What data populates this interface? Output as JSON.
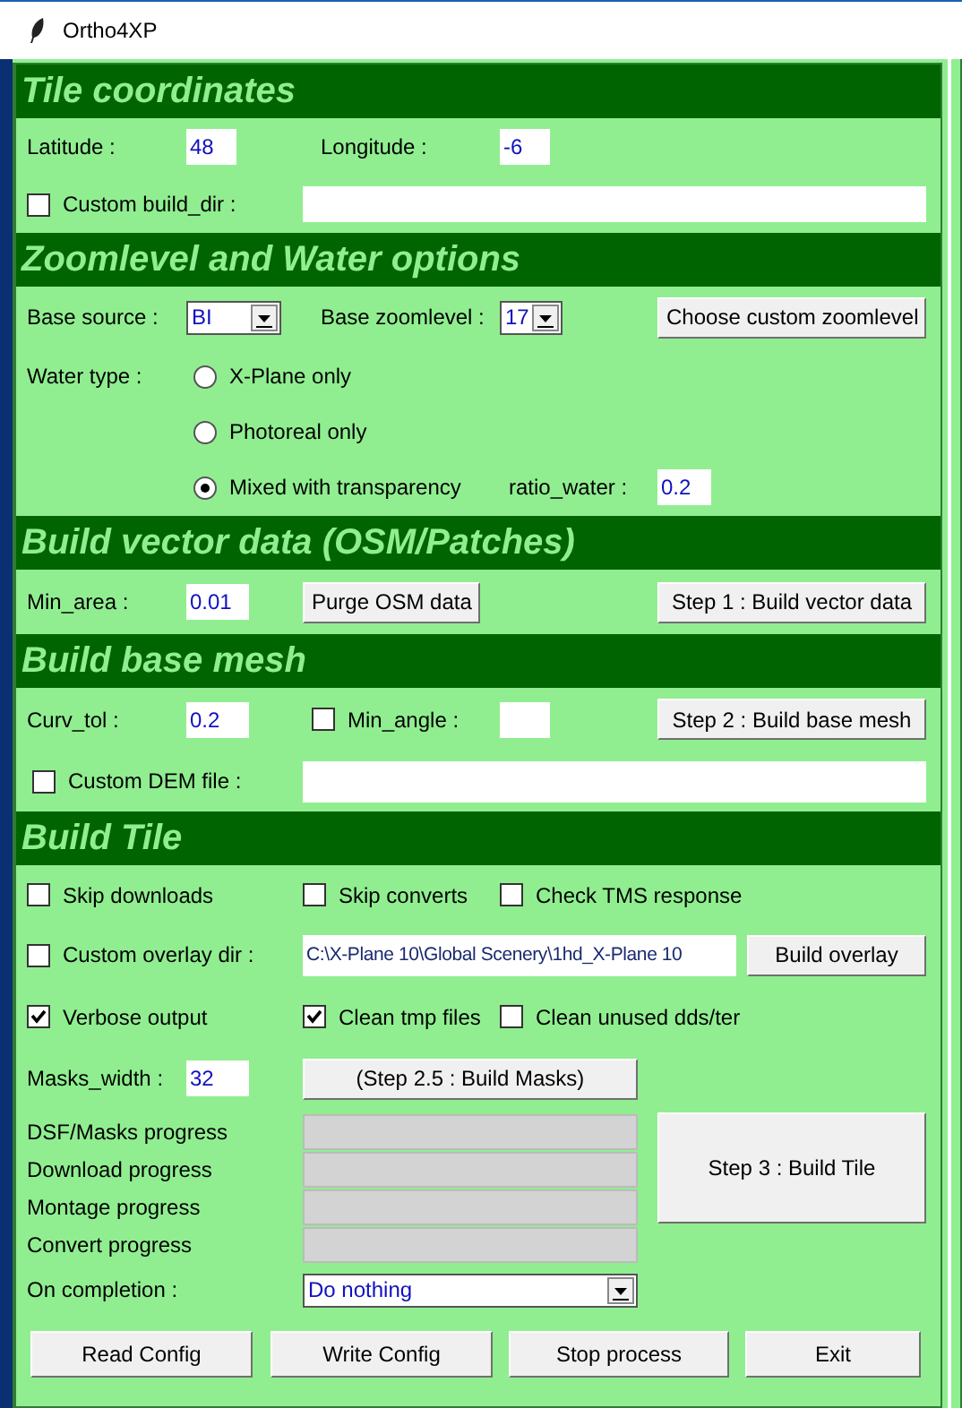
{
  "window": {
    "title": "Ortho4XP"
  },
  "tile_coordinates": {
    "title": "Tile coordinates",
    "latitude": {
      "label": "Latitude :",
      "value": "48"
    },
    "longitude": {
      "label": "Longitude :",
      "value": "-6"
    },
    "custom_build_dir": {
      "label": "Custom build_dir :",
      "checked": false
    }
  },
  "zoomlevel_water": {
    "title": "Zoomlevel and Water options",
    "base_source": {
      "label": "Base source :",
      "value": "BI"
    },
    "base_zoomlevel": {
      "label": "Base zoomlevel :",
      "value": "17"
    },
    "custom_zoomlevel_button": "Choose custom zoomlevel",
    "water_type_label": "Water type :",
    "water_types": [
      {
        "label": "X-Plane only",
        "selected": false
      },
      {
        "label": "Photoreal only",
        "selected": false
      },
      {
        "label": "Mixed with transparency",
        "selected": true
      }
    ],
    "ratio_water": {
      "label": "ratio_water :",
      "value": "0.2"
    }
  },
  "build_vector": {
    "title": "Build vector data (OSM/Patches)",
    "min_area": {
      "label": "Min_area :",
      "value": "0.01"
    },
    "purge_button": "Purge OSM data",
    "step1_button": "Step 1 : Build vector data"
  },
  "build_mesh": {
    "title": "Build base mesh",
    "curv_tol": {
      "label": "Curv_tol :",
      "value": "0.2"
    },
    "min_angle": {
      "label": "Min_angle :",
      "checked": false
    },
    "step2_button": "Step 2 : Build base mesh",
    "custom_dem": {
      "label": "Custom DEM file :",
      "checked": false
    }
  },
  "build_tile": {
    "title": "Build Tile",
    "options_row1": [
      {
        "label": "Skip downloads",
        "checked": false
      },
      {
        "label": "Skip converts",
        "checked": false
      },
      {
        "label": "Check TMS response",
        "checked": false
      }
    ],
    "custom_overlay": {
      "label": "Custom overlay dir :",
      "checked": false,
      "value": "C:\\X-Plane 10\\Global Scenery\\1hd_X-Plane 10"
    },
    "overlay_button": "Build overlay",
    "options_row2": [
      {
        "label": "Verbose output",
        "checked": true
      },
      {
        "label": "Clean tmp files",
        "checked": true
      },
      {
        "label": "Clean unused dds/ter",
        "checked": false
      }
    ],
    "masks_width": {
      "label": "Masks_width :",
      "value": "32"
    },
    "masks_button": "(Step 2.5 : Build Masks)",
    "progress": [
      {
        "label": "DSF/Masks progress",
        "level": 0
      },
      {
        "label": "Download progress",
        "level": 0
      },
      {
        "label": "Montage progress",
        "level": 0
      },
      {
        "label": "Convert progress",
        "level": 0
      }
    ],
    "step3_button": "Step 3 : Build Tile",
    "on_completion": {
      "label": "On completion :",
      "value": "Do nothing"
    }
  },
  "buttons": [
    "Read Config",
    "Write Config",
    "Stop process",
    "Exit"
  ]
}
